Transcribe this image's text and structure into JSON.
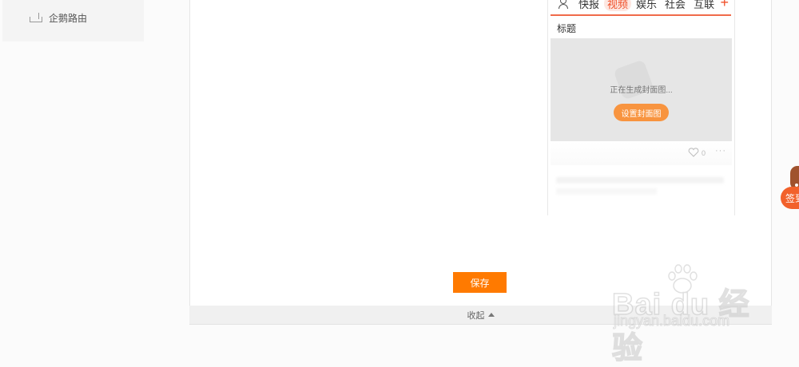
{
  "sidebar": {
    "item_label": "企鹅路由",
    "item_icon": "router-icon"
  },
  "phone_preview": {
    "tabs": [
      "快报",
      "视频",
      "娱乐",
      "社会",
      "互联"
    ],
    "active_tab": "视频",
    "title_label": "标题",
    "cover_status": "正在生成封面图...",
    "set_cover_button": "设置封面图",
    "like_count": "0",
    "more_label": "···"
  },
  "form": {
    "save_label": "保存",
    "collapse_label": "收起"
  },
  "floating": {
    "signin_label": "签到"
  },
  "watermark": {
    "main": "Bai du 经验",
    "url": "jingyan.baidu.com"
  },
  "colors": {
    "accent_orange": "#ff7a00",
    "tab_red": "#f0502a",
    "signin": "#f2612b"
  }
}
